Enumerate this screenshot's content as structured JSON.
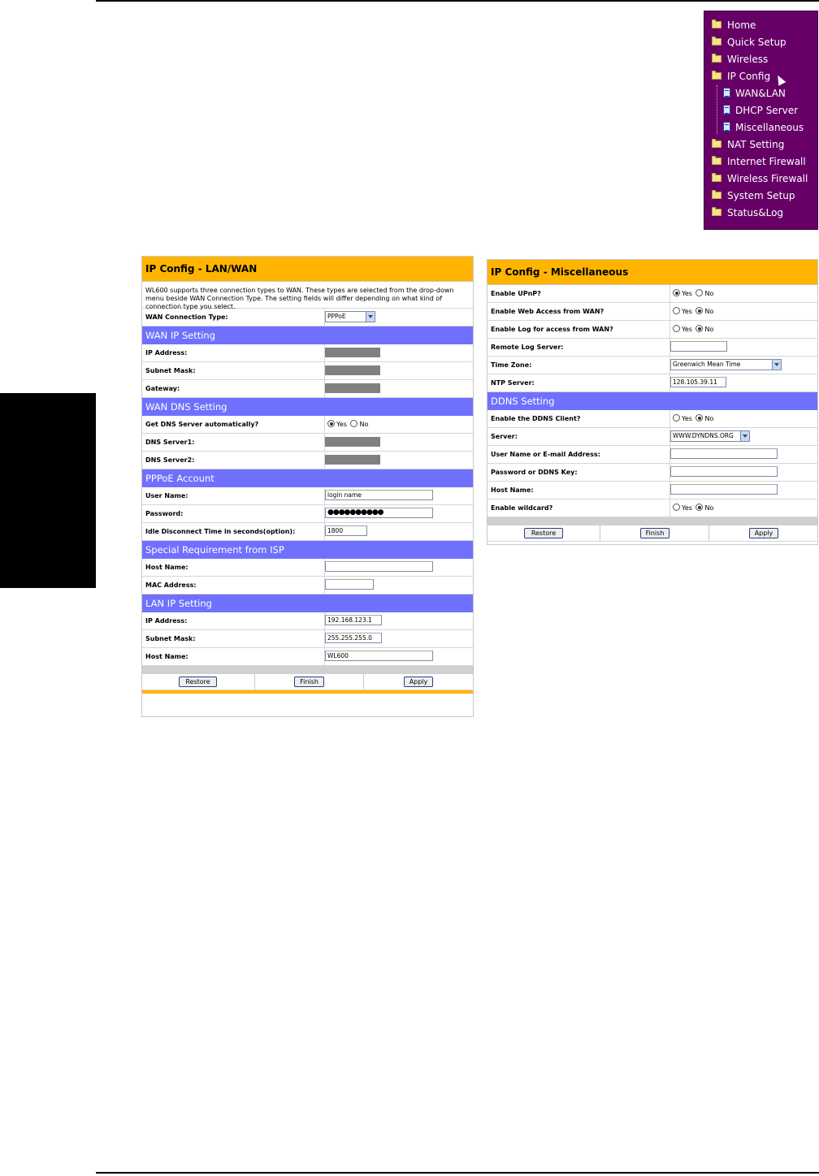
{
  "nav_menu": {
    "items": [
      {
        "label": "Home",
        "type": "folder"
      },
      {
        "label": "Quick Setup",
        "type": "folder"
      },
      {
        "label": "Wireless",
        "type": "folder"
      },
      {
        "label": "IP Config",
        "type": "folder-open"
      },
      {
        "label": "WAN&LAN",
        "type": "page"
      },
      {
        "label": "DHCP Server",
        "type": "page"
      },
      {
        "label": "Miscellaneous",
        "type": "page"
      },
      {
        "label": "NAT Setting",
        "type": "folder"
      },
      {
        "label": "Internet Firewall",
        "type": "folder"
      },
      {
        "label": "Wireless Firewall",
        "type": "folder"
      },
      {
        "label": "System Setup",
        "type": "folder"
      },
      {
        "label": "Status&Log",
        "type": "folder"
      }
    ]
  },
  "lanwan": {
    "title": "IP Config - LAN/WAN",
    "description": "WL600 supports three connection types to WAN. These types are selected from the drop-down menu beside WAN Connection Type. The setting fields will differ depending on what kind of connection type you select.",
    "wan_connection_type": {
      "label": "WAN Connection Type:",
      "value": "PPPoE"
    },
    "wan_ip": {
      "section": "WAN IP Setting",
      "ip_label": "IP Address:",
      "mask_label": "Subnet Mask:",
      "gateway_label": "Gateway:"
    },
    "wan_dns": {
      "section": "WAN DNS Setting",
      "auto_label": "Get DNS Server automatically?",
      "yes": "Yes",
      "no": "No",
      "selected": "Yes",
      "dns1_label": "DNS Server1:",
      "dns2_label": "DNS Server2:"
    },
    "pppoe": {
      "section": "PPPoE Account",
      "user_label": "User Name:",
      "user_value": "login name",
      "password_label": "Password:",
      "password_value": "●●●●●●●●●●",
      "idle_label": "Idle Disconnect Time in seconds(option):",
      "idle_value": "1800"
    },
    "isp": {
      "section": "Special Requirement from ISP",
      "host_label": "Host Name:",
      "mac_label": "MAC Address:"
    },
    "lan_ip": {
      "section": "LAN IP Setting",
      "ip_label": "IP Address:",
      "ip_value": "192.168.123.1",
      "mask_label": "Subnet Mask:",
      "mask_value": "255.255.255.0",
      "host_label": "Host Name:",
      "host_value": "WL600"
    },
    "buttons": {
      "restore": "Restore",
      "finish": "Finish",
      "apply": "Apply"
    }
  },
  "misc": {
    "title": "IP Config - Miscellaneous",
    "upnp": {
      "label": "Enable UPnP?",
      "yes": "Yes",
      "no": "No",
      "selected": "Yes"
    },
    "web_access": {
      "label": "Enable Web Access from WAN?",
      "yes": "Yes",
      "no": "No",
      "selected": "No"
    },
    "log_access": {
      "label": "Enable Log for access from WAN?",
      "yes": "Yes",
      "no": "No",
      "selected": "No"
    },
    "remote_log": {
      "label": "Remote Log Server:",
      "value": ""
    },
    "time_zone": {
      "label": "Time Zone:",
      "value": "Greenwich Mean Time"
    },
    "ntp": {
      "label": "NTP Server:",
      "value": "128.105.39.11"
    },
    "ddns": {
      "section": "DDNS Setting",
      "enable": {
        "label": "Enable the DDNS Client?",
        "yes": "Yes",
        "no": "No",
        "selected": "No"
      },
      "server": {
        "label": "Server:",
        "value": "WWW.DYNDNS.ORG"
      },
      "user": {
        "label": "User Name or E-mail Address:"
      },
      "password": {
        "label": "Password or DDNS Key:"
      },
      "host": {
        "label": "Host Name:"
      },
      "wildcard": {
        "label": "Enable wildcard?",
        "yes": "Yes",
        "no": "No",
        "selected": "No"
      }
    },
    "buttons": {
      "restore": "Restore",
      "finish": "Finish",
      "apply": "Apply"
    }
  },
  "colors": {
    "nav_bg": "#660066",
    "title_bar": "#ffb400",
    "section_bar": "#7070ff",
    "side_tab": "#000000"
  }
}
